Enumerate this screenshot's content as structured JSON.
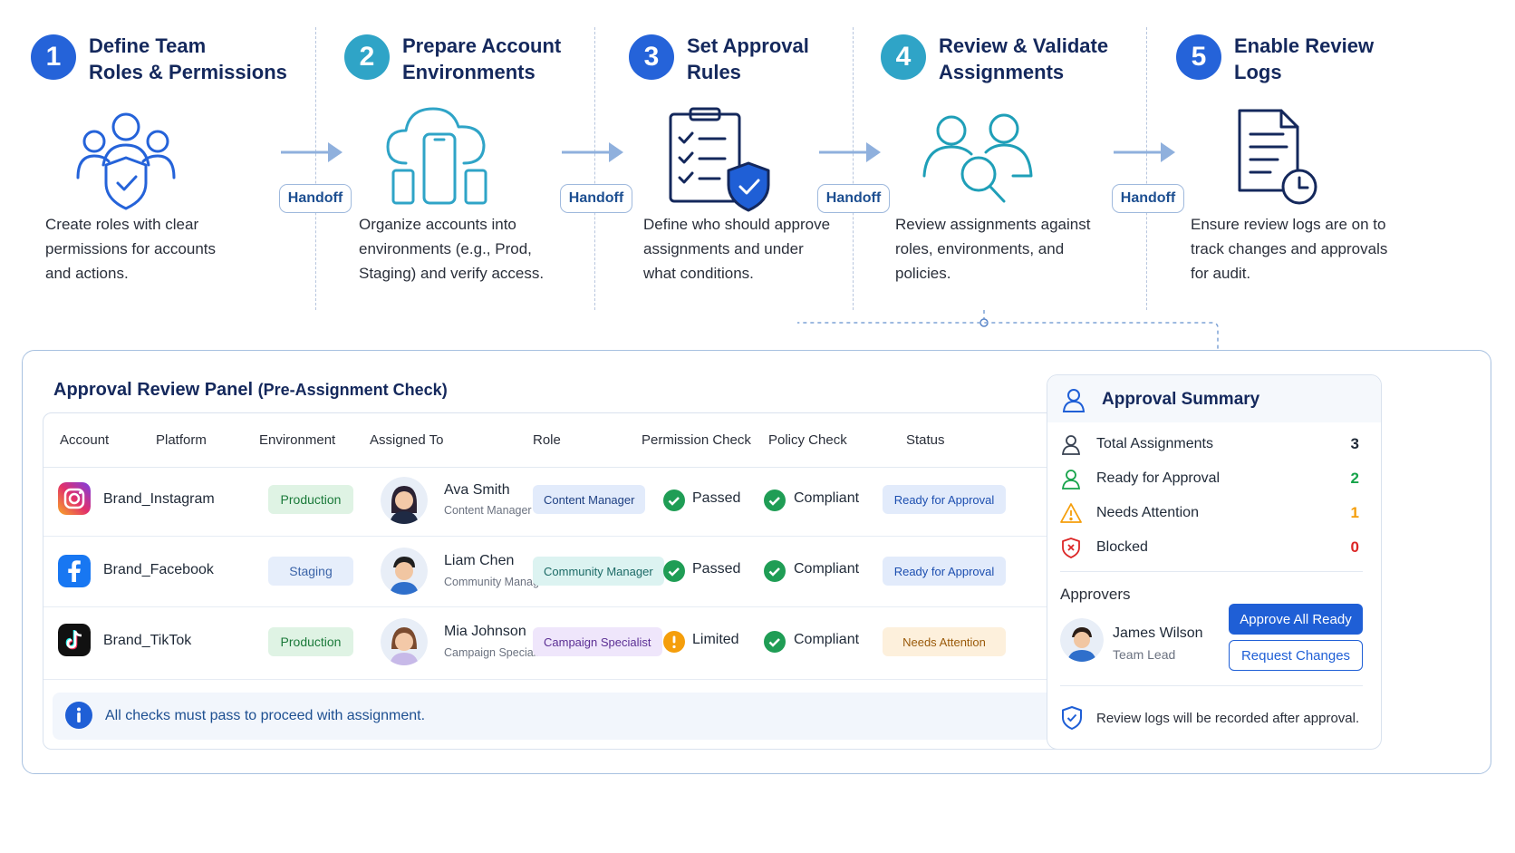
{
  "steps": [
    {
      "number": "1",
      "title": "Define Team\nRoles & Permissions",
      "description": "Create roles with clear\npermissions for accounts\nand actions.",
      "color": "#2563d9",
      "illustration": "team-shield-icon"
    },
    {
      "number": "2",
      "title": "Prepare Account\nEnvironments",
      "description": "Organize accounts into\nenvironments (e.g., Prod,\nStaging) and verify access.",
      "color": "#2fa4c7",
      "illustration": "cloud-devices-icon"
    },
    {
      "number": "3",
      "title": "Set Approval\nRules",
      "description": "Define who should approve\nassignments and under\nwhat conditions.",
      "color": "#2563d9",
      "illustration": "checklist-shield-icon"
    },
    {
      "number": "4",
      "title": "Review & Validate\nAssignments",
      "description": "Review assignments against\nroles, environments, and\npolicies.",
      "color": "#2fa4c7",
      "illustration": "people-search-icon"
    },
    {
      "number": "5",
      "title": "Enable Review\nLogs",
      "description": "Ensure review logs are on to\ntrack changes and approvals\nfor audit.",
      "color": "#2563d9",
      "illustration": "document-clock-icon"
    }
  ],
  "handoff_label": "Handoff",
  "panel": {
    "title": "Approval Review Panel",
    "subtitle": "(Pre-Assignment Check)",
    "columns": [
      "Account",
      "Platform",
      "Environment",
      "Assigned To",
      "Role",
      "Permission Check",
      "Policy Check",
      "Status"
    ],
    "rows": [
      {
        "account": "Brand_Instagram",
        "platform_icon": "instagram-icon",
        "environment": "Production",
        "person": "Ava Smith",
        "person_title": "Content Manager",
        "role": "Content Manager",
        "permission": "Passed",
        "permission_state": "ok",
        "policy": "Compliant",
        "status": "Ready for Approval",
        "status_state": "ready"
      },
      {
        "account": "Brand_Facebook",
        "platform_icon": "facebook-icon",
        "environment": "Staging",
        "person": "Liam Chen",
        "person_title": "Community Manager",
        "role": "Community Manager",
        "permission": "Passed",
        "permission_state": "ok",
        "policy": "Compliant",
        "status": "Ready for Approval",
        "status_state": "ready"
      },
      {
        "account": "Brand_TikTok",
        "platform_icon": "tiktok-icon",
        "environment": "Production",
        "person": "Mia Johnson",
        "person_title": "Campaign Specialist",
        "role": "Campaign Specialist",
        "permission": "Limited",
        "permission_state": "warn",
        "policy": "Compliant",
        "status": "Needs Attention",
        "status_state": "attention"
      }
    ],
    "info_text": "All checks must pass to proceed with assignment."
  },
  "summary": {
    "title": "Approval Summary",
    "items": [
      {
        "label": "Total Assignments",
        "count": "3",
        "color": "#1f2937",
        "icon": "user-icon"
      },
      {
        "label": "Ready for Approval",
        "count": "2",
        "color": "#16a34a",
        "icon": "user-check-icon"
      },
      {
        "label": "Needs Attention",
        "count": "1",
        "color": "#f59e0b",
        "icon": "warning-icon"
      },
      {
        "label": "Blocked",
        "count": "0",
        "color": "#dc2626",
        "icon": "blocked-shield-icon"
      }
    ],
    "approvers_label": "Approvers",
    "approver_name": "James Wilson",
    "approver_role": "Team Lead",
    "approve_button": "Approve All Ready",
    "request_button": "Request Changes",
    "log_note": "Review logs will be recorded after approval."
  }
}
